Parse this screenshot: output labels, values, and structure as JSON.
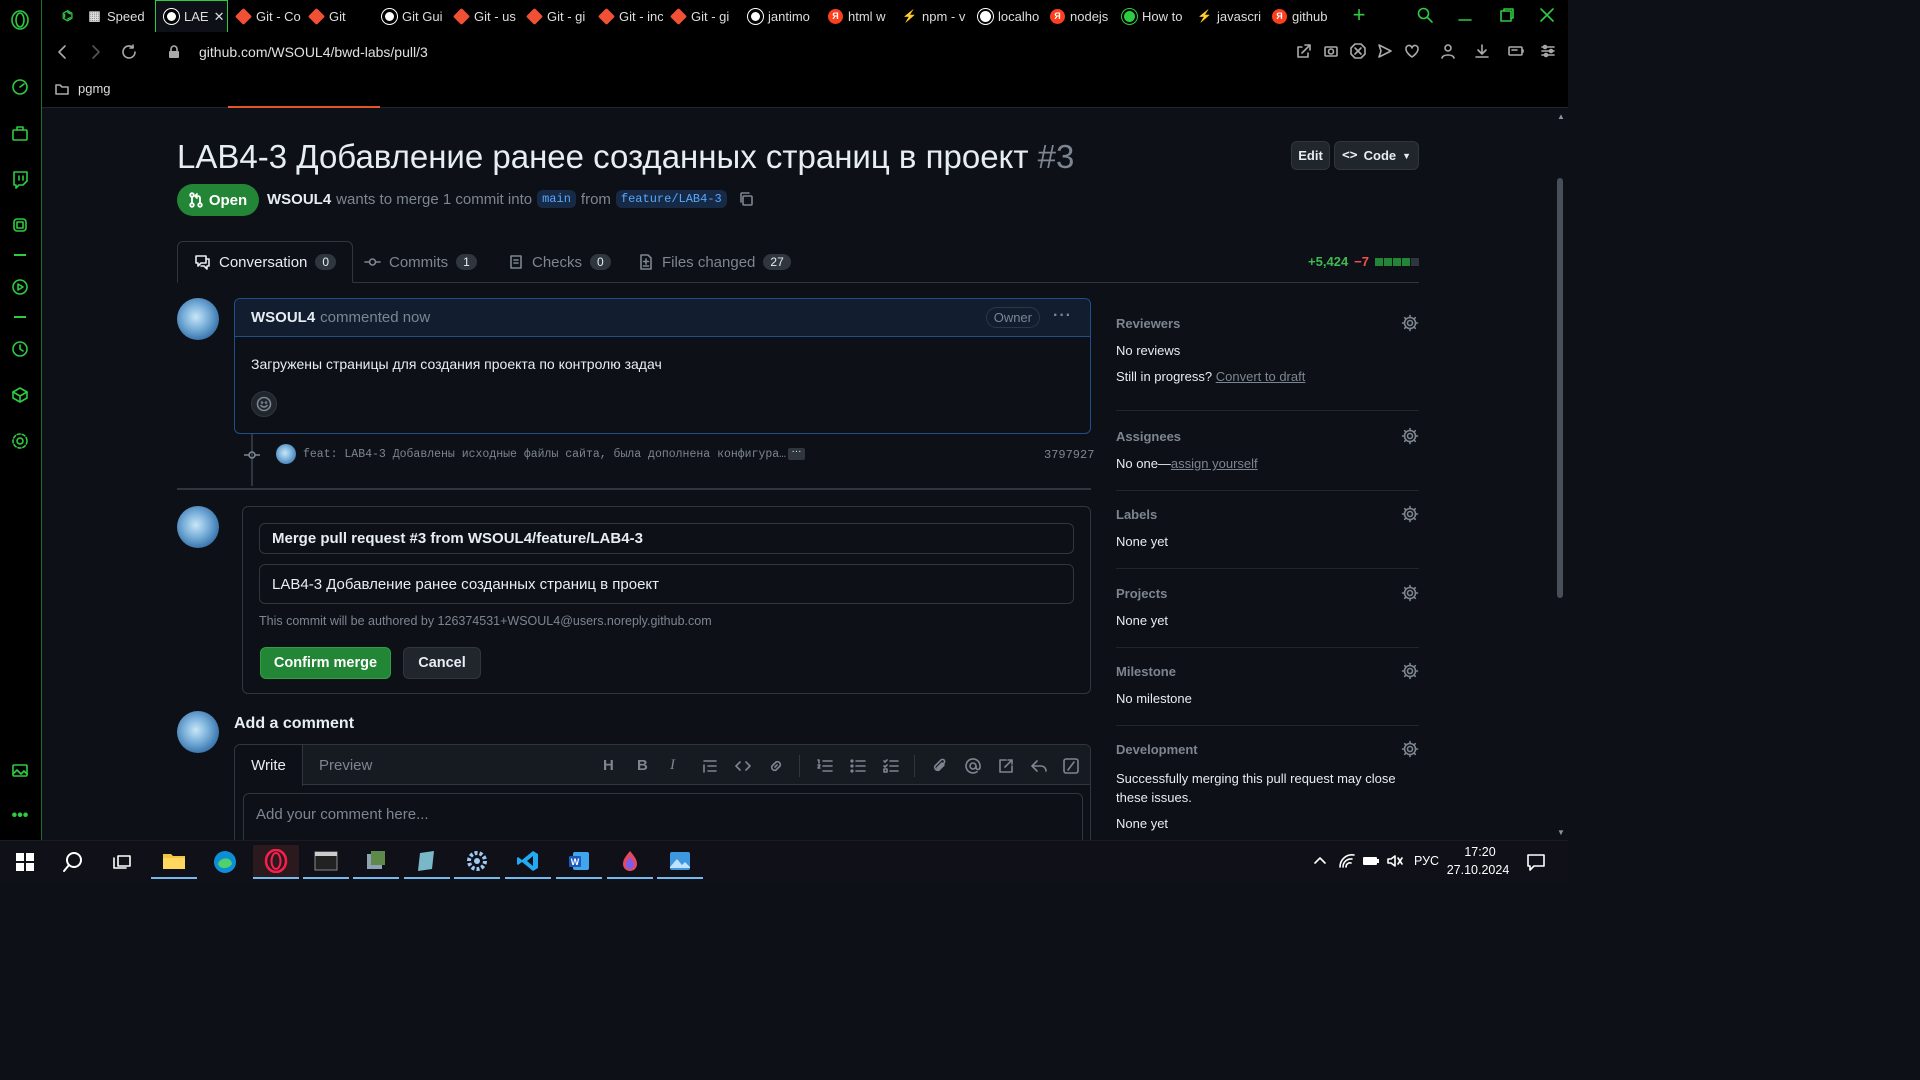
{
  "browser": {
    "tabs": [
      {
        "label": "",
        "fav": "gamepad-icon",
        "color": "#2ecc40"
      },
      {
        "label": "Speed",
        "fav": "grid",
        "color": "#ddd"
      },
      {
        "label": "LAE",
        "fav": "github",
        "color": "#fff"
      },
      {
        "label": "Git - Co",
        "fav": "git",
        "color": "#f05033"
      },
      {
        "label": "Git",
        "fav": "git",
        "color": "#f05033"
      },
      {
        "label": "Git Gui",
        "fav": "github",
        "color": "#fff"
      },
      {
        "label": "Git - us",
        "fav": "git",
        "color": "#f05033"
      },
      {
        "label": "Git - gi",
        "fav": "git",
        "color": "#f05033"
      },
      {
        "label": "Git - inc",
        "fav": "git",
        "color": "#f05033"
      },
      {
        "label": "Git - gi",
        "fav": "git",
        "color": "#f05033"
      },
      {
        "label": "jantimo",
        "fav": "github",
        "color": "#fff"
      },
      {
        "label": "html w",
        "fav": "yandex",
        "color": "#fc3f1d"
      },
      {
        "label": "npm - v",
        "fav": "npm",
        "color": "#f05033"
      },
      {
        "label": "localho",
        "fav": "globe",
        "color": "#fff"
      },
      {
        "label": "nodejs",
        "fav": "yandex",
        "color": "#fc3f1d"
      },
      {
        "label": "How to",
        "fav": "globe",
        "color": "#2ecc40"
      },
      {
        "label": "javascri",
        "fav": "npm",
        "color": "#f05033"
      },
      {
        "label": "github",
        "fav": "yandex",
        "color": "#fc3f1d"
      }
    ],
    "url": "github.com/WSOUL4/bwd-labs/pull/3",
    "bookmark_folder": "pgmg"
  },
  "pr": {
    "title": "LAB4-3 Добавление ранее созданных страниц в проект",
    "number": "#3",
    "edit_label": "Edit",
    "code_label": "Code",
    "state": "Open",
    "author": "WSOUL4",
    "merge_text": "wants to merge 1 commit into",
    "base_branch": "main",
    "from_text": "from",
    "head_branch": "feature/LAB4-3",
    "tabs": [
      {
        "label": "Conversation",
        "count": "0"
      },
      {
        "label": "Commits",
        "count": "1"
      },
      {
        "label": "Checks",
        "count": "0"
      },
      {
        "label": "Files changed",
        "count": "27"
      }
    ],
    "diff_add": "+5,424",
    "diff_del": "−7",
    "comment": {
      "author": "WSOUL4",
      "time": "commented now",
      "badge": "Owner",
      "body": "Загружены страницы для создания проекта по контролю задач"
    },
    "commit": {
      "message": "feat: LAB4-3 Добавлены исходные файлы сайта, была дополнена конфигура…",
      "sha": "3797927"
    },
    "merge_box": {
      "title_value": "Merge pull request #3 from WSOUL4/feature/LAB4-3",
      "body_value": "LAB4-3 Добавление ранее созданных страниц в проект",
      "author_note": "This commit will be authored by 126374531+WSOUL4@users.noreply.github.com",
      "confirm_label": "Confirm merge",
      "cancel_label": "Cancel"
    },
    "add_comment": {
      "heading": "Add a comment",
      "write_tab": "Write",
      "preview_tab": "Preview",
      "placeholder": "Add your comment here..."
    }
  },
  "sidebar": {
    "reviewers": {
      "title": "Reviewers",
      "value": "No reviews",
      "draft_q": "Still in progress?",
      "draft_link": "Convert to draft"
    },
    "assignees": {
      "title": "Assignees",
      "value": "No one—",
      "link": "assign yourself"
    },
    "labels": {
      "title": "Labels",
      "value": "None yet"
    },
    "projects": {
      "title": "Projects",
      "value": "None yet"
    },
    "milestone": {
      "title": "Milestone",
      "value": "No milestone"
    },
    "development": {
      "title": "Development",
      "value": "Successfully merging this pull request may close these issues.",
      "value2": "None yet"
    }
  },
  "taskbar": {
    "language": "РУС",
    "time": "17:20",
    "date": "27.10.2024"
  },
  "colors": {
    "accent_green": "#238636",
    "link_blue": "#58a6ff",
    "opera_green": "#2ecc40"
  }
}
